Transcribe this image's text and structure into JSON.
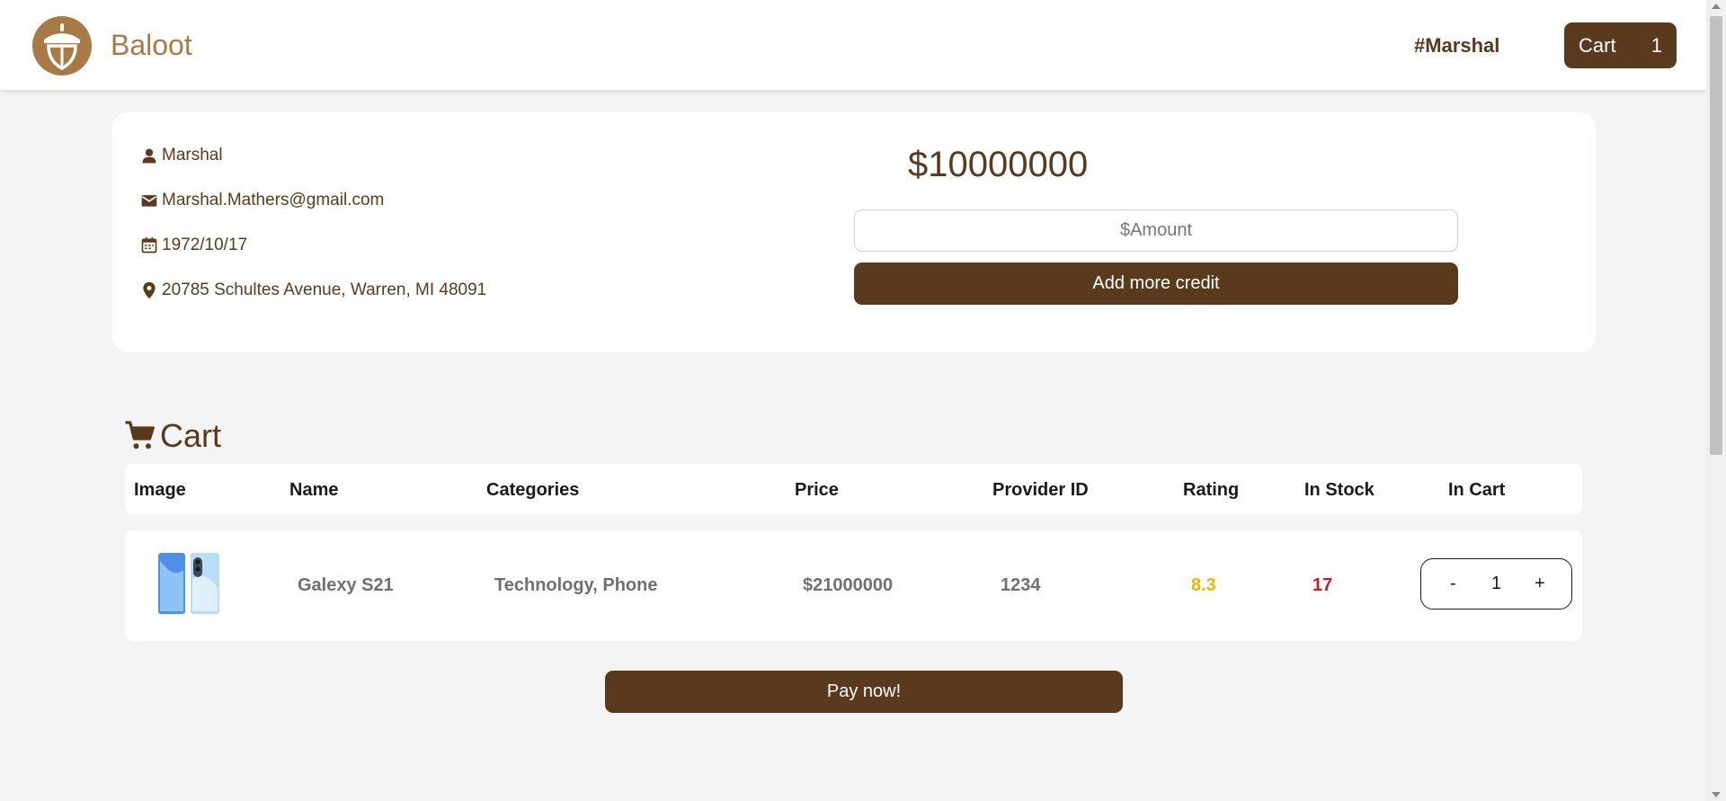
{
  "brand": {
    "name": "Baloot"
  },
  "header": {
    "username": "#Marshal",
    "cart_label": "Cart",
    "cart_count": "1"
  },
  "profile": {
    "username": "Marshal",
    "email": "Marshal.Mathers@gmail.com",
    "birth_date": "1972/10/17",
    "address": "20785 Schultes Avenue, Warren, MI 48091",
    "credit": "$10000000",
    "amount_placeholder": "$Amount",
    "add_credit_label": "Add more credit"
  },
  "cart": {
    "title": "Cart",
    "columns": [
      "Image",
      "Name",
      "Categories",
      "Price",
      "Provider ID",
      "Rating",
      "In Stock",
      "In Cart"
    ],
    "items": [
      {
        "name": "Galexy S21",
        "categories": "Technology, Phone",
        "price": "$21000000",
        "provider_id": "1234",
        "rating": "8.3",
        "in_stock": "17",
        "quantity": "1",
        "minus": "-",
        "plus": "+"
      }
    ],
    "pay_label": "Pay now!"
  },
  "colors": {
    "primary": "#5a3a1c",
    "brand": "#a87a45",
    "rating": "#f0b400",
    "stock": "#c81e1e"
  }
}
